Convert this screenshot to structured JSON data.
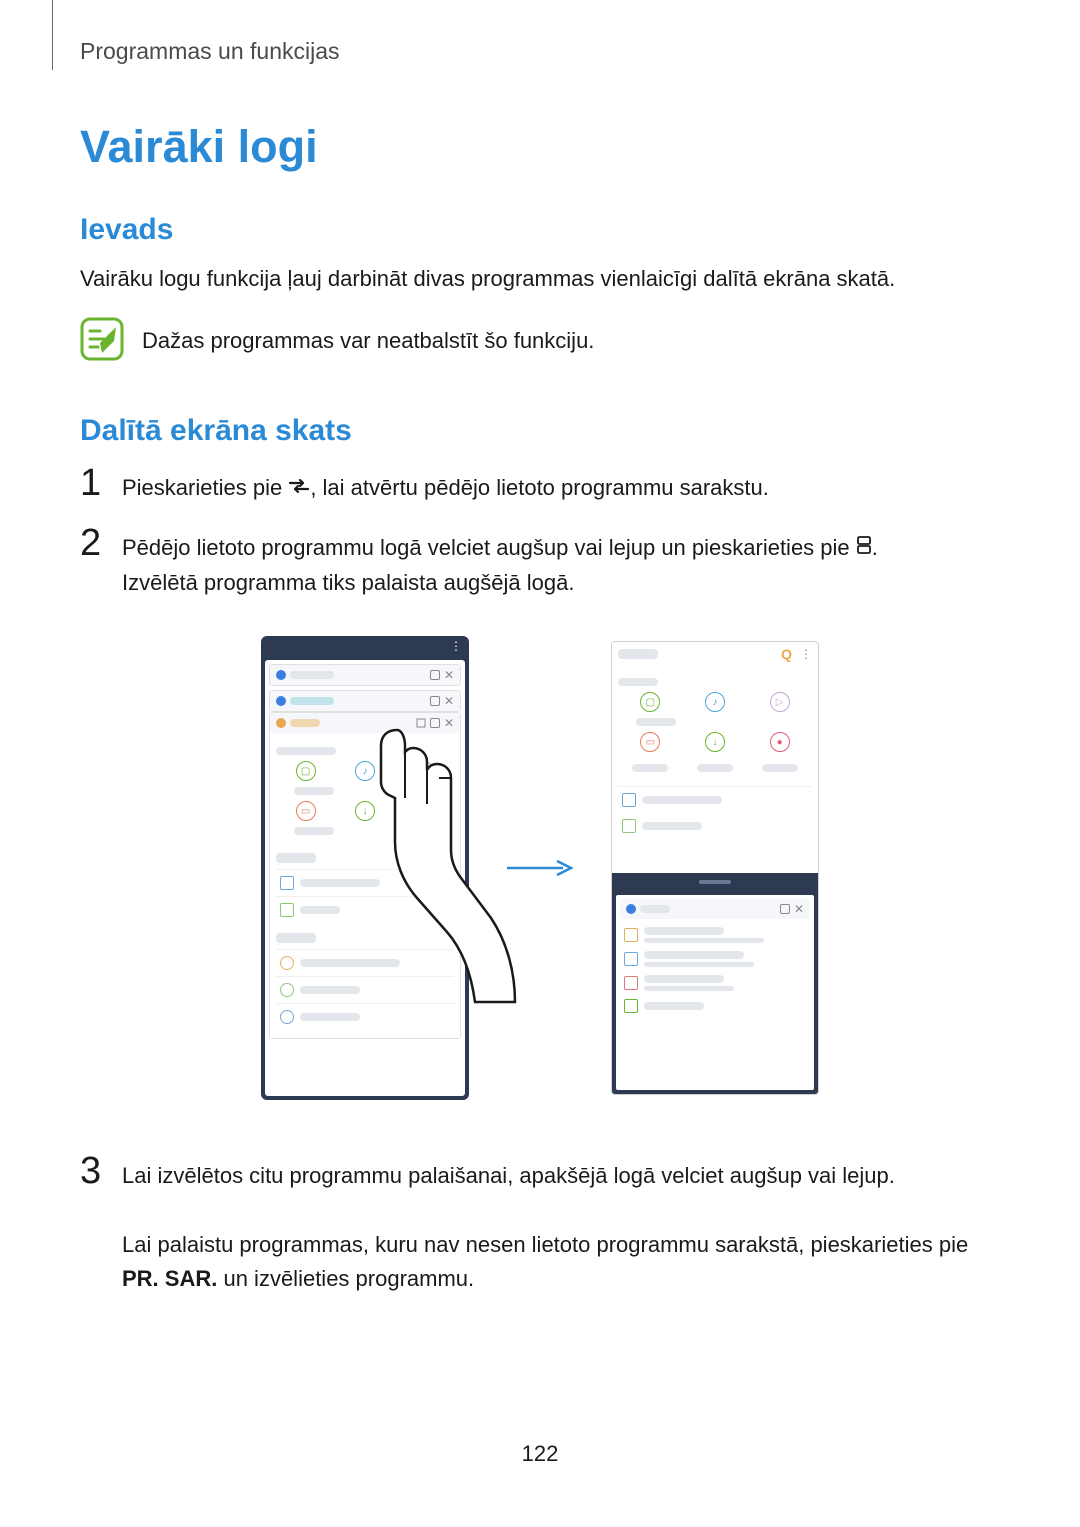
{
  "breadcrumb": "Programmas un funkcijas",
  "title": "Vairāki logi",
  "section_intro_title": "Ievads",
  "section_intro_text": "Vairāku logu funkcija ļauj darbināt divas programmas vienlaicīgi dalītā ekrāna skatā.",
  "note_text": "Dažas programmas var neatbalstīt šo funkciju.",
  "section_split_title": "Dalītā ekrāna skats",
  "steps": {
    "s1": {
      "num": "1",
      "text_before": "Pieskarieties pie ",
      "text_after": ", lai atvērtu pēdējo lietoto programmu sarakstu."
    },
    "s2": {
      "num": "2",
      "text_before": "Pēdējo lietoto programmu logā velciet augšup vai lejup un pieskarieties pie ",
      "text_after": ".",
      "text_line2": "Izvēlētā programma tiks palaista augšējā logā."
    },
    "s3": {
      "num": "3",
      "text1": "Lai izvēlētos citu programmu palaišanai, apakšējā logā velciet augšup vai lejup.",
      "text2_before": "Lai palaistu programmas, kuru nav nesen lietoto programmu sarakstā, pieskarieties pie ",
      "text2_bold": "PR. SAR.",
      "text2_after": " un izvēlieties programmu."
    }
  },
  "page_number": "122"
}
